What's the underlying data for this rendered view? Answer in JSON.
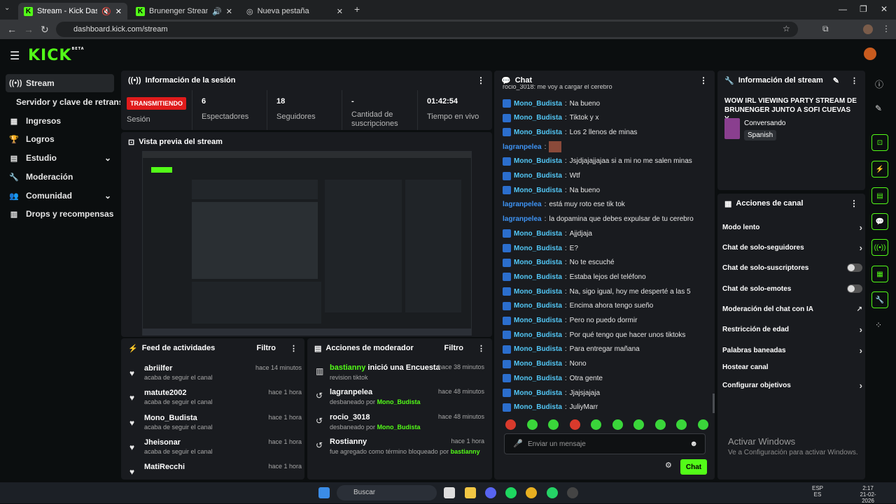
{
  "browser": {
    "tabs": [
      {
        "title": "Stream - Kick Dashboard"
      },
      {
        "title": "Brunenger Stream - Watch"
      },
      {
        "title": "Nueva pestaña"
      }
    ],
    "url": "dashboard.kick.com/stream"
  },
  "brand": {
    "logo": "KICK",
    "beta": "BETA",
    "accent": "#53fc18"
  },
  "sidebar": {
    "items": [
      {
        "label": "Stream"
      },
      {
        "label": "Servidor y clave de retransm"
      },
      {
        "label": "Ingresos"
      },
      {
        "label": "Logros"
      },
      {
        "label": "Estudio"
      },
      {
        "label": "Moderación"
      },
      {
        "label": "Comunidad"
      },
      {
        "label": "Drops y recompensas"
      }
    ]
  },
  "session": {
    "title": "Información de la sesión",
    "badge": "TRANSMITIENDO",
    "session_label": "Sesión",
    "stats": [
      {
        "value": "6",
        "label": "Espectadores"
      },
      {
        "value": "18",
        "label": "Seguidores"
      },
      {
        "value": "-",
        "label": "Cantidad de suscripciones"
      },
      {
        "value": "01:42:54",
        "label": "Tiempo en vivo"
      }
    ]
  },
  "preview": {
    "title": "Vista previa del stream"
  },
  "feed": {
    "title": "Feed de actividades",
    "filter": "Filtro",
    "items": [
      {
        "name": "abriilfer",
        "sub": "acaba de seguir el canal",
        "time": "hace 14 minutos"
      },
      {
        "name": "matute2002",
        "sub": "acaba de seguir el canal",
        "time": "hace 1 hora"
      },
      {
        "name": "Mono_Budista",
        "sub": "acaba de seguir el canal",
        "time": "hace 1 hora"
      },
      {
        "name": "Jheisonar",
        "sub": "acaba de seguir el canal",
        "time": "hace 1 hora"
      },
      {
        "name": "MatiRecchi",
        "sub": "",
        "time": "hace 1 hora"
      }
    ]
  },
  "modactions": {
    "title": "Acciones de moderador",
    "filter": "Filtro",
    "items": [
      {
        "name": "bastianny",
        "name_rest": " inició una Encuesta",
        "sub": "revision tiktok",
        "sub_by": "",
        "time": "hace 38 minutos"
      },
      {
        "name": "lagranpelea",
        "name_rest": "",
        "sub": "desbaneado por ",
        "sub_by": "Mono_Budista",
        "time": "hace 48 minutos"
      },
      {
        "name": "rocio_3018",
        "name_rest": "",
        "sub": "desbaneado por ",
        "sub_by": "Mono_Budista",
        "time": "hace 48 minutos"
      },
      {
        "name": "Rostianny",
        "name_rest": "",
        "sub": "fue agregado como término bloqueado por ",
        "sub_by": "bastianny",
        "time": "hace 1 hora"
      }
    ]
  },
  "chat": {
    "title": "Chat",
    "top_line": "rocio_3018: me voy a cargar el cerebro",
    "messages": [
      {
        "user": "Mono_Budista",
        "text": "Na bueno"
      },
      {
        "user": "Mono_Budista",
        "text": "Tiktok y x"
      },
      {
        "user": "Mono_Budista",
        "text": "Los 2 llenos de minas"
      },
      {
        "user": "lagranpelea",
        "text": ""
      },
      {
        "user": "Mono_Budista",
        "text": "Jsjdjajajjajaa si a mi no me salen minas"
      },
      {
        "user": "Mono_Budista",
        "text": "Wtf"
      },
      {
        "user": "Mono_Budista",
        "text": "Na bueno"
      },
      {
        "user": "lagranpelea",
        "text": "está muy roto ese tik tok"
      },
      {
        "user": "lagranpelea",
        "text": "la dopamina que debes expulsar de tu cerebro"
      },
      {
        "user": "Mono_Budista",
        "text": "Ajjdjaja"
      },
      {
        "user": "Mono_Budista",
        "text": "E?"
      },
      {
        "user": "Mono_Budista",
        "text": "No te escuché"
      },
      {
        "user": "Mono_Budista",
        "text": "Estaba lejos del teléfono"
      },
      {
        "user": "Mono_Budista",
        "text": "Na, sigo igual, hoy me desperté a las 5"
      },
      {
        "user": "Mono_Budista",
        "text": "Encima ahora tengo sueño"
      },
      {
        "user": "Mono_Budista",
        "text": "Pero no puedo dormir"
      },
      {
        "user": "Mono_Budista",
        "text": "Por qué tengo que hacer unos tiktoks"
      },
      {
        "user": "Mono_Budista",
        "text": "Para entregar mañana"
      },
      {
        "user": "Mono_Budista",
        "text": "Nono"
      },
      {
        "user": "Mono_Budista",
        "text": "Otra gente"
      },
      {
        "user": "Mono_Budista",
        "text": "Jjajsjajaja"
      },
      {
        "user": "Mono_Budista",
        "text": "JuliyMarr"
      }
    ],
    "placeholder": "Enviar un mensaje",
    "send": "Chat"
  },
  "streaminfo": {
    "title": "Información del stream",
    "stream_title": "WOW IRL VIEWING PARTY STREAM DE BRUNENGER JUNTO A SOFI CUEVAS Y...",
    "category": "Conversando",
    "language": "Spanish"
  },
  "channel": {
    "title": "Acciones de canal",
    "items": [
      {
        "label": "Modo lento",
        "ctrl": "chev"
      },
      {
        "label": "Chat de solo-seguidores",
        "ctrl": "chev"
      },
      {
        "label": "Chat de solo-suscriptores",
        "ctrl": "toggle"
      },
      {
        "label": "Chat de solo-emotes",
        "ctrl": "toggle"
      },
      {
        "label": "Moderación del chat con IA",
        "ctrl": "ext"
      },
      {
        "label": "Restricción de edad",
        "ctrl": "chev"
      },
      {
        "label": "Palabras baneadas",
        "ctrl": "chev"
      },
      {
        "label": "Hostear canal",
        "ctrl": "none"
      },
      {
        "label": "Configurar objetivos",
        "ctrl": "chev"
      }
    ]
  },
  "watermark": {
    "title": "Activar Windows",
    "sub": "Ve a Configuración para activar Windows."
  },
  "taskbar": {
    "search": "Buscar",
    "lang1": "ESP",
    "lang2": "ES",
    "time": "2:17",
    "date": "21-02-2026"
  }
}
